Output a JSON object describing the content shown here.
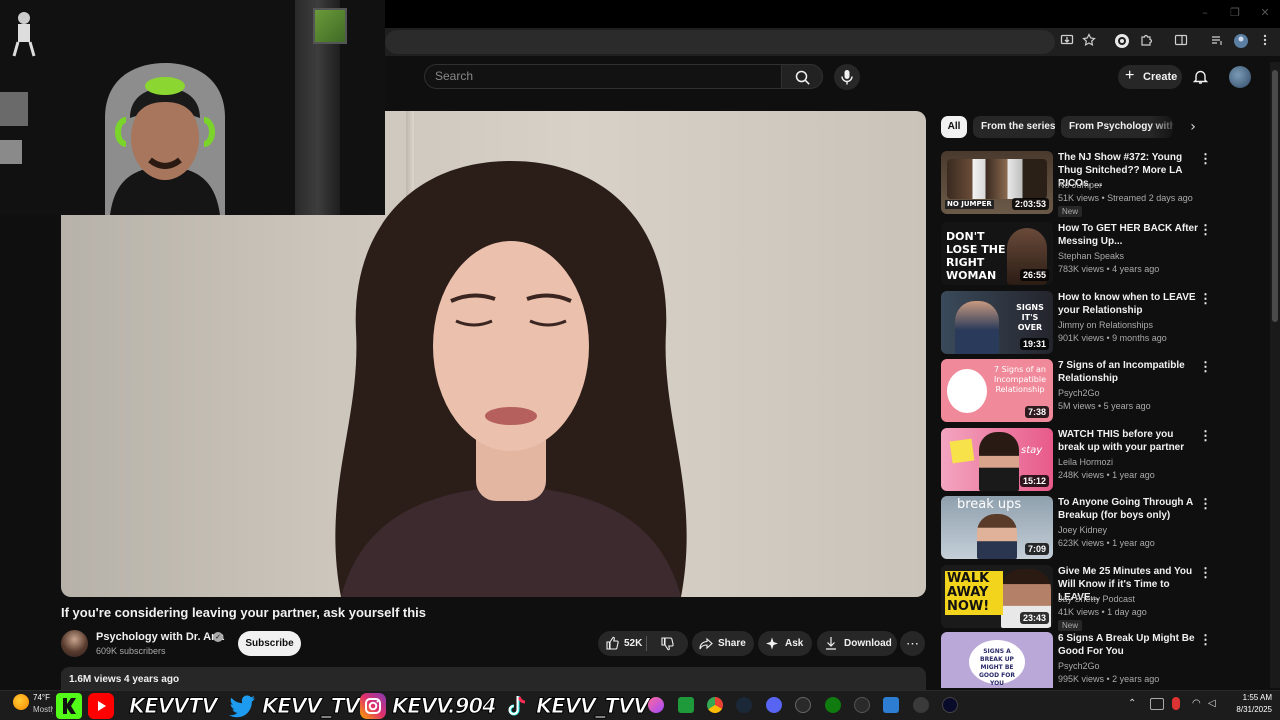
{
  "browser": {
    "window_controls": [
      "–",
      "❐",
      "✕"
    ]
  },
  "masthead": {
    "search_placeholder": "Search",
    "create_label": "Create"
  },
  "video": {
    "title": "If you're considering leaving your partner, ask yourself this",
    "channel": "Psychology with Dr. Ana",
    "subscribers": "609K subscribers",
    "subscribe_label": "Subscribe",
    "likes": "52K",
    "share_label": "Share",
    "ask_label": "Ask",
    "download_label": "Download",
    "views_date": "1.6M views  4 years ago"
  },
  "chips": [
    "All",
    "From the series",
    "From Psychology with Dr. Ana"
  ],
  "recommendations": [
    {
      "title": "The NJ Show #372: Young Thug Snitched?? More LA RICOs, ...",
      "channel": "No Jumper",
      "meta": "51K views • Streamed 2 days ago",
      "duration": "2:03:53",
      "badge": "New",
      "thumb_text": "NO JUMPER",
      "thumb_bg": "#5a4a3a"
    },
    {
      "title": "How To GET HER BACK After Messing Up...",
      "channel": "Stephan Speaks",
      "meta": "783K views • 4 years ago",
      "duration": "26:55",
      "badge": "",
      "thumb_text": "DON'T LOSE THE RIGHT WOMAN",
      "thumb_bg": "#1a1a1a"
    },
    {
      "title": "How to know when to LEAVE your Relationship",
      "channel": "Jimmy on Relationships",
      "meta": "901K views • 9 months ago",
      "duration": "19:31",
      "badge": "",
      "thumb_text": "SIGNS IT'S OVER",
      "thumb_bg": "#2c2c34"
    },
    {
      "title": "7 Signs of an Incompatible Relationship",
      "channel": "Psych2Go",
      "meta": "5M views • 5 years ago",
      "duration": "7:38",
      "badge": "",
      "thumb_text": "7 Signs of an Incompatible Relationship",
      "thumb_bg": "#f08a9a"
    },
    {
      "title": "WATCH THIS before you break up with your partner",
      "channel": "Leila Hormozi",
      "meta": "248K views • 1 year ago",
      "duration": "15:12",
      "badge": "",
      "thumb_text": "stay",
      "thumb_bg": "#e85a8a"
    },
    {
      "title": "To Anyone Going Through A Breakup (for boys only)",
      "channel": "Joey Kidney",
      "meta": "623K views • 1 year ago",
      "duration": "7:09",
      "badge": "",
      "thumb_text": "break ups",
      "thumb_bg": "#9aa8b4"
    },
    {
      "title": "Give Me 25 Minutes and You Will Know if it's Time to LEAVE...",
      "channel": "Jay Shetty Podcast",
      "meta": "41K views • 1 day ago",
      "duration": "23:43",
      "badge": "New",
      "thumb_text": "WALK AWAY NOW!",
      "thumb_bg": "#f2d41c"
    },
    {
      "title": "6 Signs A Break Up Might Be Good For You",
      "channel": "Psych2Go",
      "meta": "995K views • 2 years ago",
      "duration": "",
      "badge": "",
      "thumb_text": "SIGNS A BREAK UP MIGHT BE GOOD FOR YOU",
      "thumb_bg": "#b9a8d8"
    }
  ],
  "taskbar": {
    "weather_temp": "74°F",
    "weather_desc": "Mostly clear",
    "social": [
      "KEVVTV",
      "KEVV_TV",
      "KEVV.904",
      "KEVV_TVV"
    ],
    "time": "1:55 AM",
    "date": "8/31/2025"
  },
  "colors": {
    "background": "#0f0f0f",
    "pill": "#272727",
    "subscribe": "#f1f1f1",
    "kick": "#53fc18",
    "youtube": "#ff0000",
    "twitter": "#1d9bf0",
    "instagram": "#c13584"
  }
}
